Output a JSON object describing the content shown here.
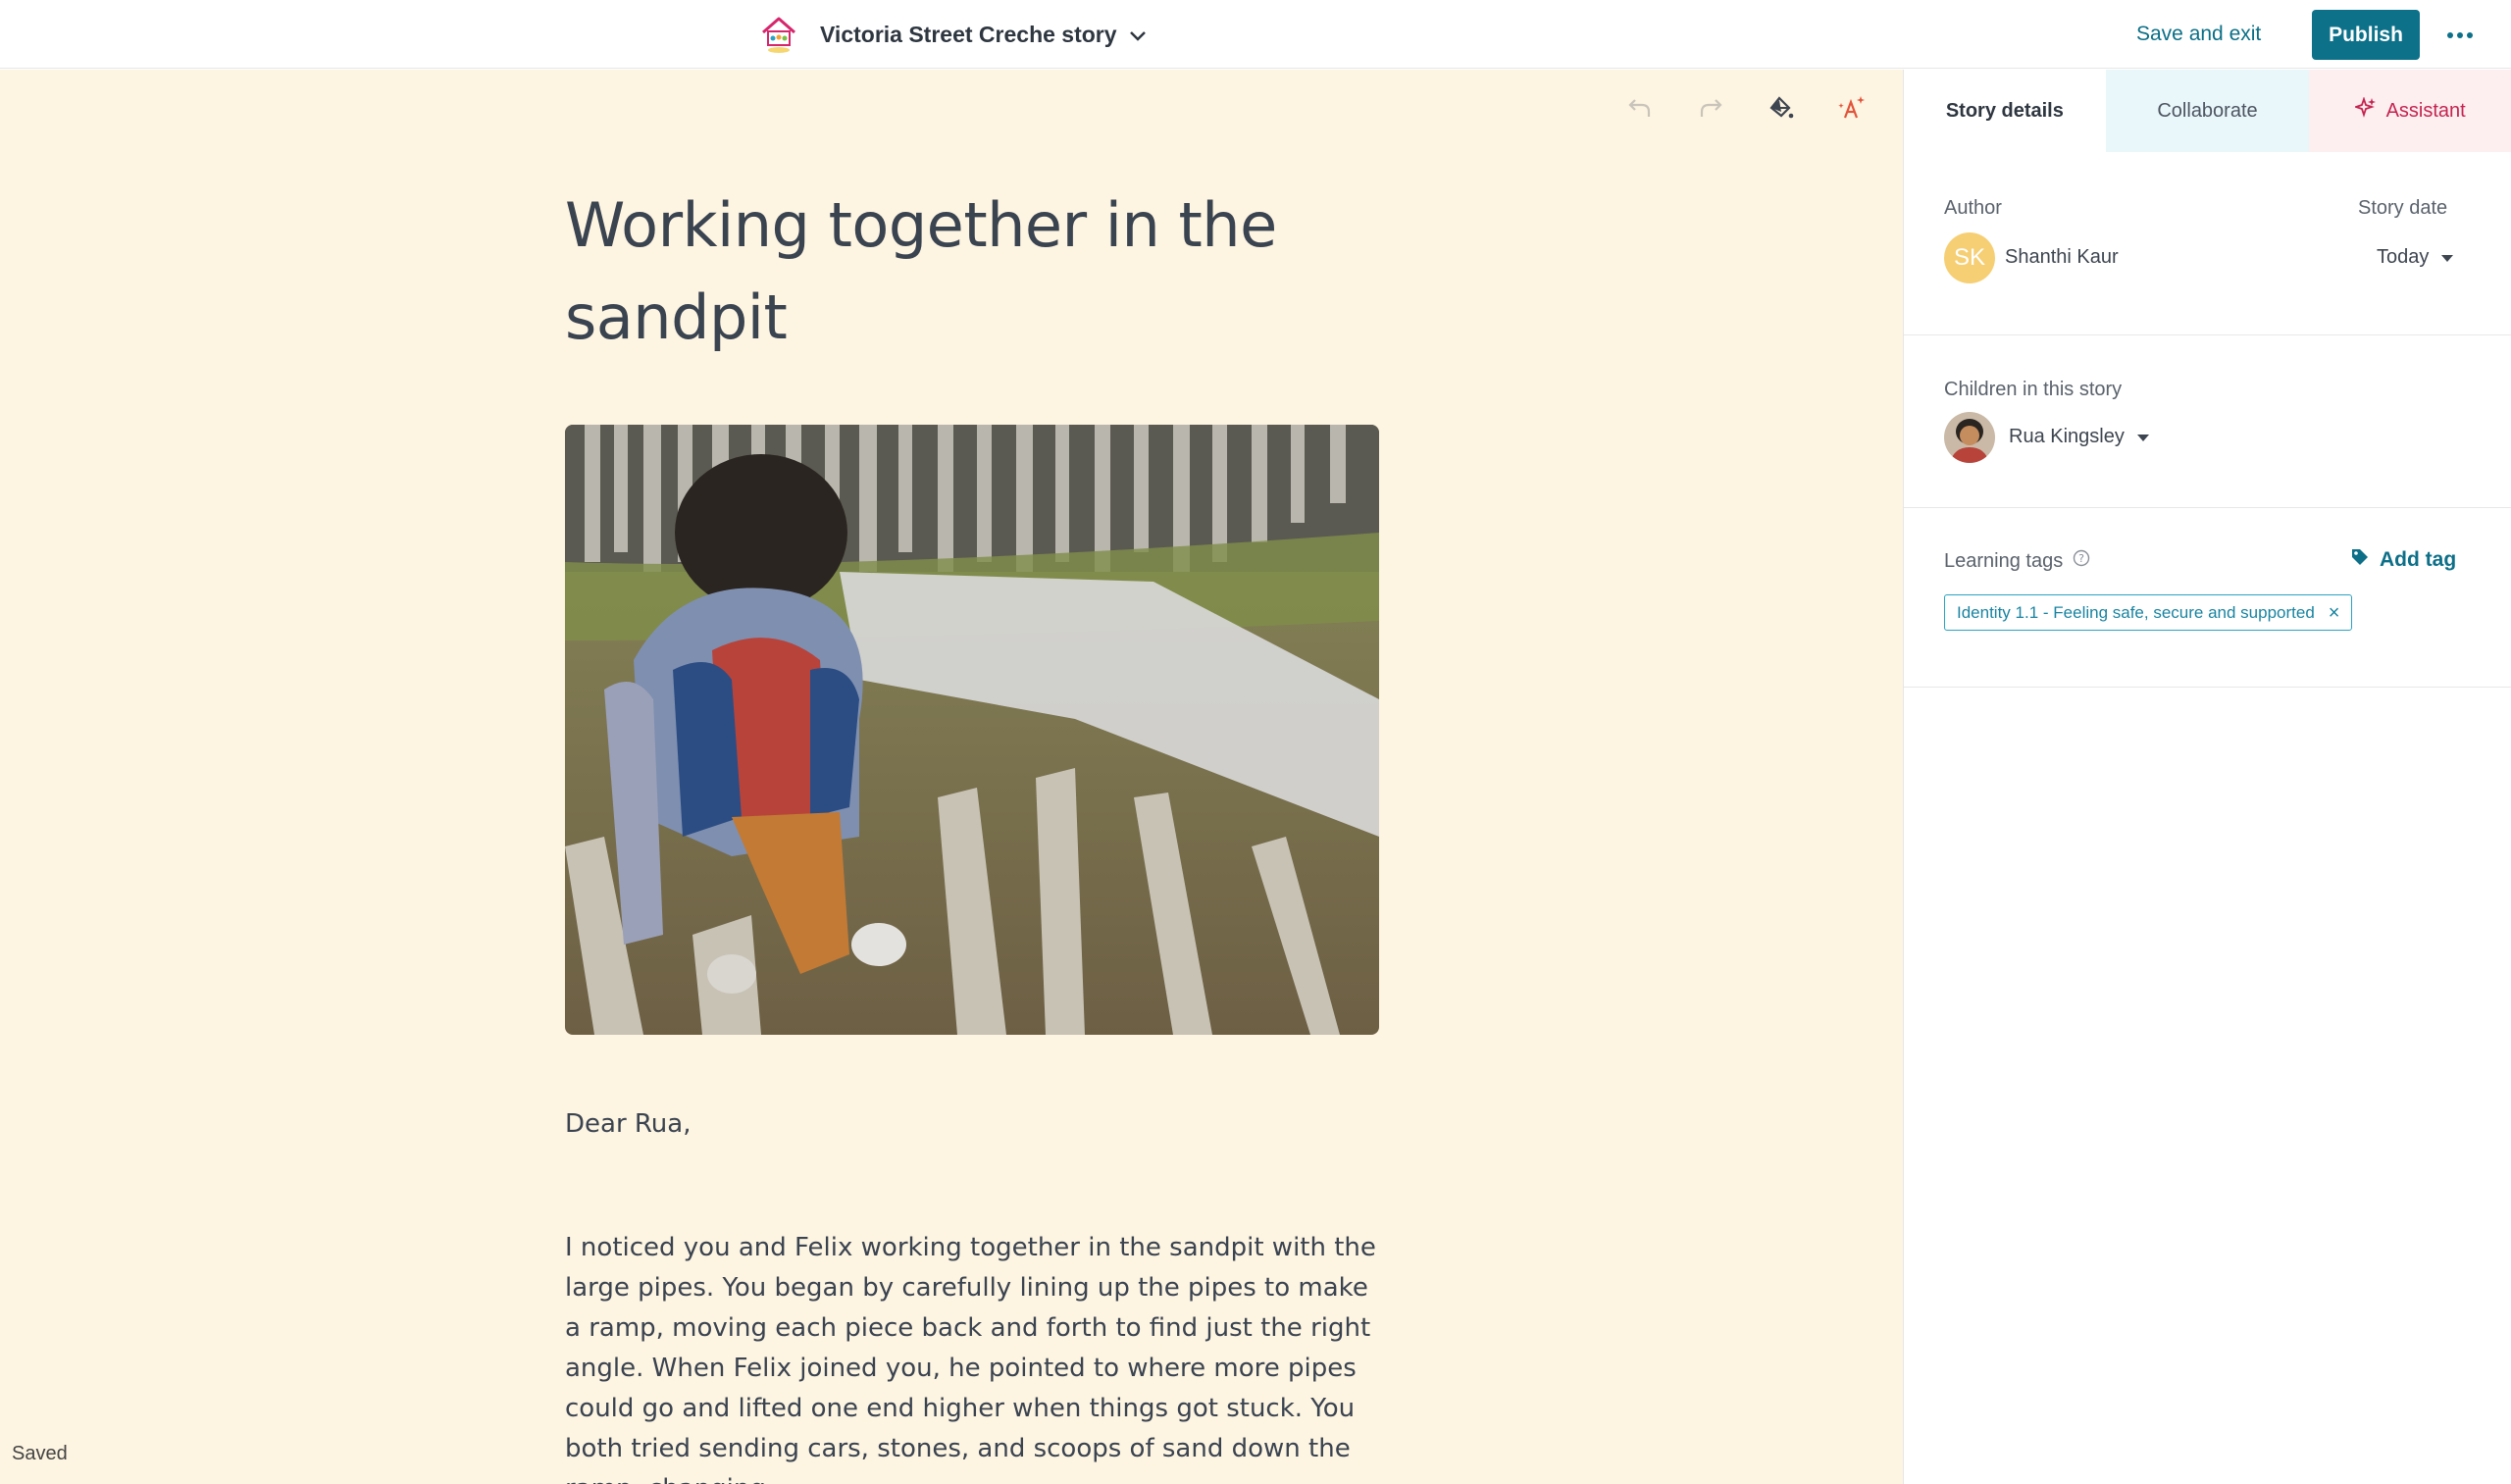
{
  "header": {
    "story_title": "Victoria Street Creche story",
    "save_exit_label": "Save and exit",
    "publish_label": "Publish"
  },
  "editor": {
    "title": "Working together in the sandpit",
    "greeting": "Dear Rua,",
    "body": "I noticed you and Felix working together in the sandpit with the large pipes. You began by carefully lining up the pipes to make a ramp, moving each piece back and forth to find just the right angle. When Felix joined you, he pointed to where more pipes could go and lifted one end higher when things got stuck. You both tried sending cars, stones, and scoops of sand down the ramp, changing",
    "status": "Saved"
  },
  "sidebar": {
    "tabs": {
      "details": "Story details",
      "collaborate": "Collaborate",
      "assistant": "Assistant"
    },
    "author": {
      "label": "Author",
      "initials": "SK",
      "name": "Shanthi Kaur"
    },
    "story_date": {
      "label": "Story date",
      "value": "Today"
    },
    "children": {
      "label": "Children in this story",
      "name": "Rua Kingsley"
    },
    "learning_tags": {
      "label": "Learning tags",
      "add_label": "Add tag",
      "tags": [
        "Identity 1.1 - Feeling safe, secure and supported"
      ]
    }
  },
  "colors": {
    "accent": "#0d7189",
    "editor_bg": "#fdf4e1",
    "assistant": "#c4244f",
    "tag": "#1a84a1"
  },
  "icons": {
    "undo": "undo-icon",
    "redo": "redo-icon",
    "theme": "paint-bucket-icon",
    "ai": "sparkle-text-icon",
    "more": "more-horizontal-icon"
  }
}
